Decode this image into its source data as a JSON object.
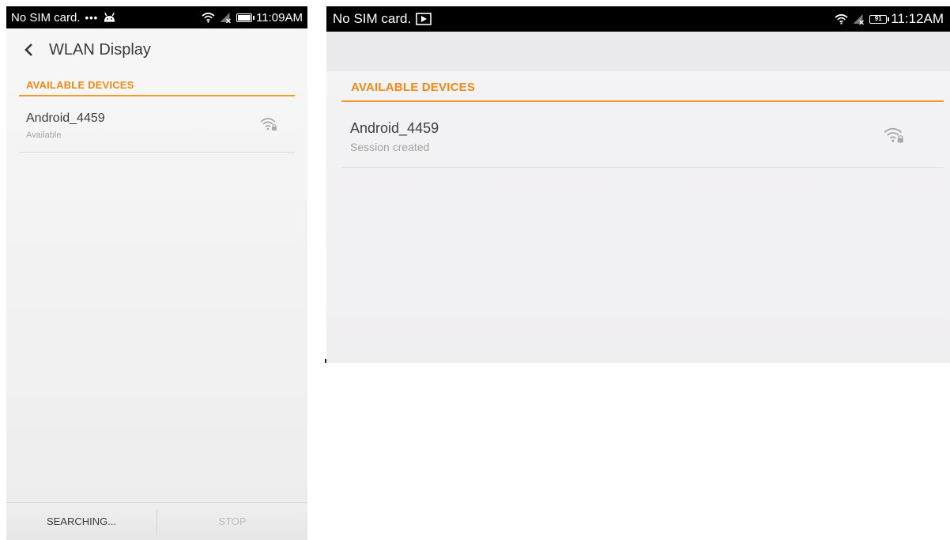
{
  "left_screen": {
    "statusbar": {
      "carrier": "No SIM card.",
      "dots": "•••",
      "time": "11:09AM"
    },
    "header": {
      "title": "WLAN Display"
    },
    "section_title": "AVAILABLE DEVICES",
    "devices": [
      {
        "name": "Android_4459",
        "status": "Available",
        "icon": "wifi-lock-icon"
      }
    ],
    "bottom_bar": {
      "search_label": "SEARCHING...",
      "stop_label": "STOP"
    }
  },
  "right_screen": {
    "statusbar": {
      "carrier": "No SIM card.",
      "battery": "91",
      "time": "11:12AM"
    },
    "section_title": "AVAILABLE DEVICES",
    "devices": [
      {
        "name": "Android_4459",
        "status": "Session created",
        "icon": "wifi-lock-icon"
      }
    ]
  },
  "colors": {
    "accent": "#f08a18",
    "statusbar": "#000000",
    "background": "#f2f2f2"
  }
}
